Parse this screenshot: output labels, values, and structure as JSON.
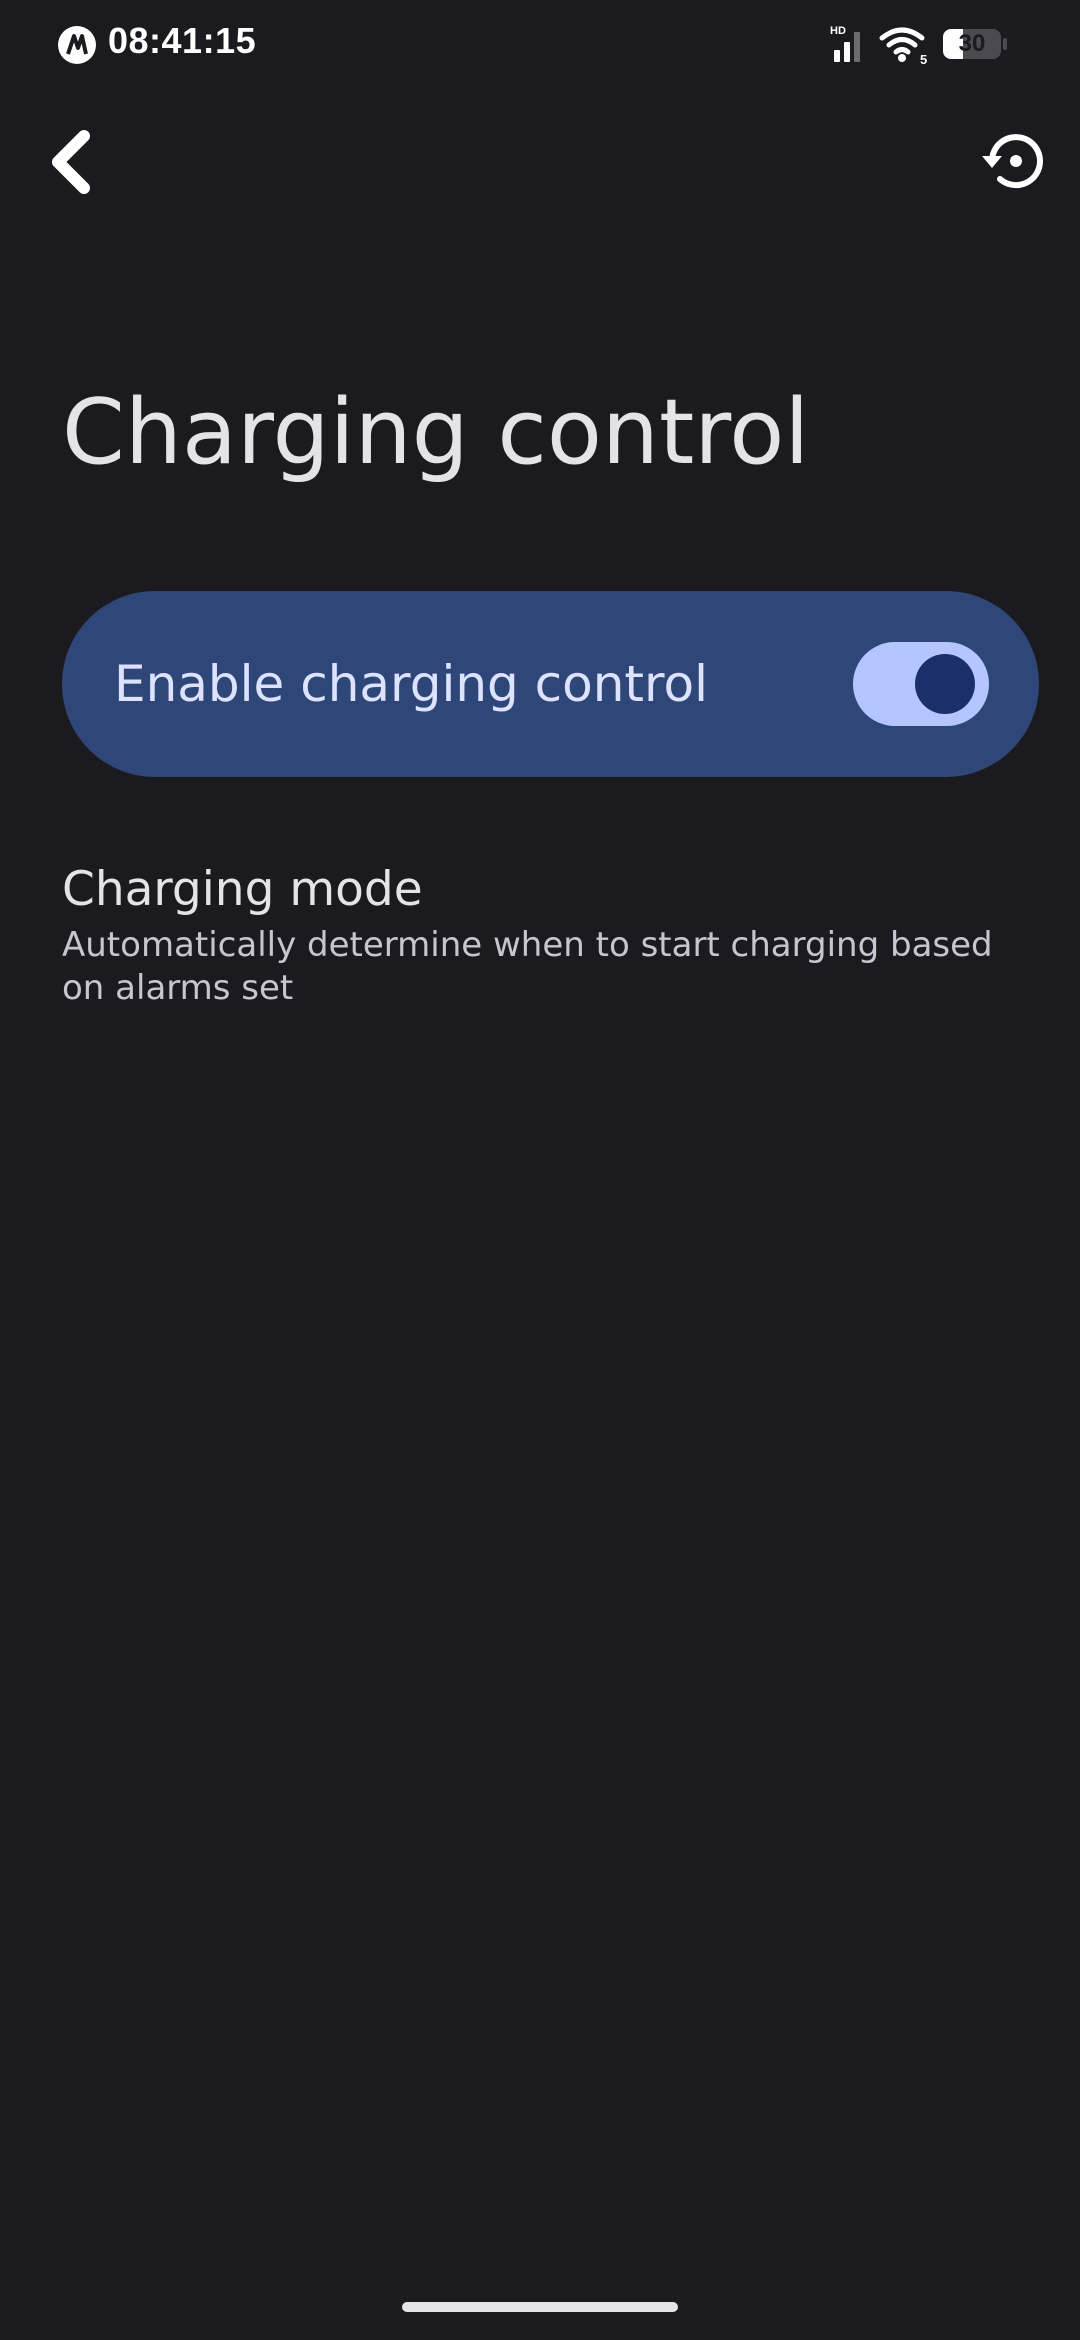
{
  "status_bar": {
    "time": "08:41:15",
    "signal_badge": "HD",
    "wifi_badge": "5",
    "battery_level": "30"
  },
  "app_bar": {
    "back_icon": "chevron-left-icon",
    "reset_icon": "history-icon"
  },
  "page": {
    "title": "Charging control"
  },
  "main_switch": {
    "label": "Enable charging control",
    "enabled": true
  },
  "preferences": [
    {
      "title": "Charging mode",
      "summary": "Automatically determine when to start charging based on alarms set"
    }
  ],
  "colors": {
    "background": "#1b1b1f",
    "card": "#2f4679",
    "switch_track": "#b4c5ff",
    "switch_thumb": "#1b3068",
    "text_primary": "#e4e3e8",
    "text_secondary": "#c5c6d0"
  }
}
